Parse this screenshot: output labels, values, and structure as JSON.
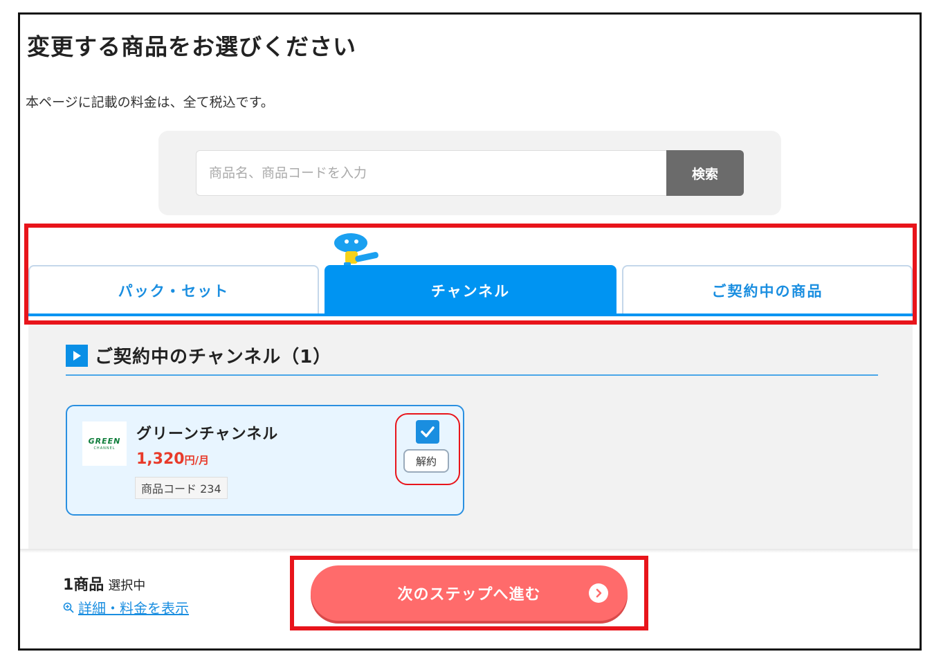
{
  "header": {
    "title": "変更する商品をお選びください",
    "tax_note": "本ページに記載の料金は、全て税込です。"
  },
  "search": {
    "placeholder": "商品名、商品コードを入力",
    "button_label": "検索"
  },
  "tabs": [
    {
      "label": "パック・セット",
      "active": false
    },
    {
      "label": "チャンネル",
      "active": true
    },
    {
      "label": "ご契約中の商品",
      "active": false
    }
  ],
  "section": {
    "title": "ご契約中のチャンネル（1）"
  },
  "product": {
    "logo_text": "GREEN",
    "logo_subtext": "CHANNEL",
    "name": "グリーンチャンネル",
    "price": "1,320",
    "price_unit": "円/月",
    "code": "商品コード 234",
    "cancel_label": "解約",
    "cancel_checked": true
  },
  "footer": {
    "selected_count": "1商品",
    "selected_text": "選択中",
    "detail_link": "詳細・料金を表示",
    "next_button": "次のステップへ進む"
  },
  "colors": {
    "accent_blue": "#0094f2",
    "highlight_red": "#e8141b",
    "price_red": "#e83a2a",
    "next_button": "#ff6b6b"
  },
  "icons": [
    "play-icon",
    "check-icon",
    "zoom-icon",
    "chevron-right-icon",
    "mascot-icon"
  ]
}
